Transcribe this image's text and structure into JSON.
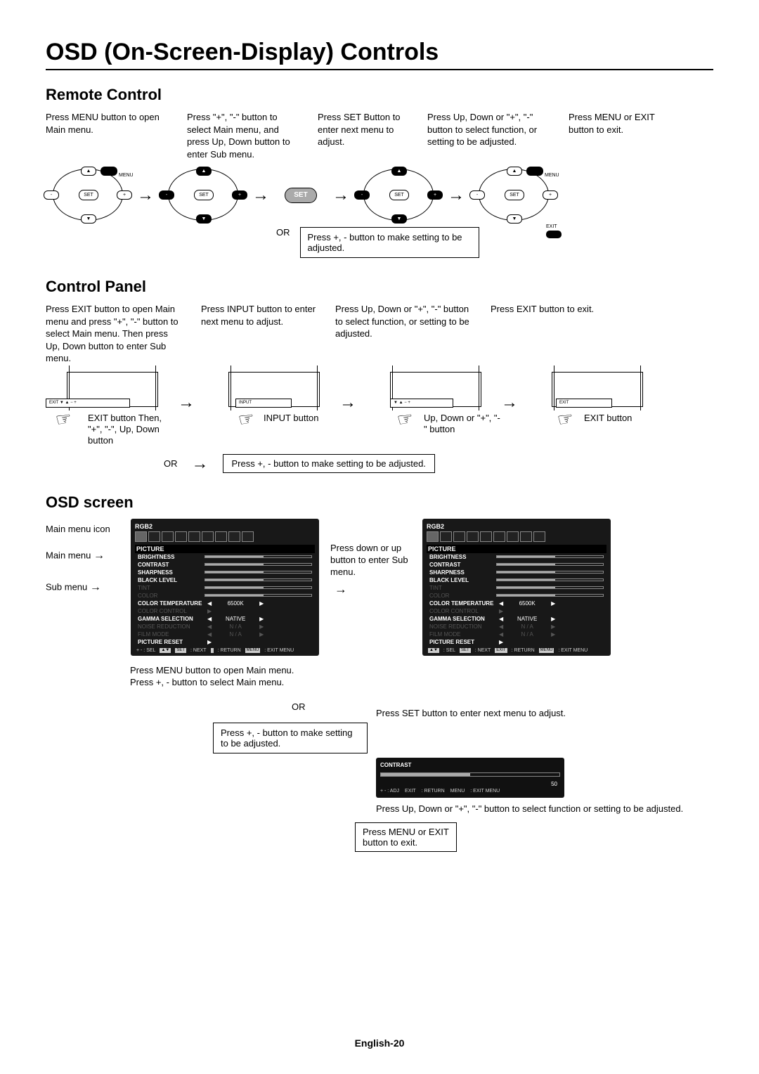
{
  "title": "OSD (On-Screen-Display) Controls",
  "footer": "English-20",
  "sections": {
    "remote": {
      "heading": "Remote Control",
      "steps": [
        "Press MENU button to open Main menu.",
        "Press \"+\", \"-\" button to select Main menu, and press Up, Down button to enter Sub menu.",
        "Press SET Button to enter next menu to adjust.",
        "Press Up, Down or \"+\", \"-\" button to select function, or setting to be adjusted.",
        "Press MENU or EXIT button to exit."
      ],
      "or": "OR",
      "or_text": "Press +, - button to make setting to be adjusted.",
      "btn_set": "SET",
      "btn_menu": "MENU",
      "btn_exit": "EXIT",
      "plus": "+",
      "minus": "-",
      "up": "▲",
      "down": "▼"
    },
    "panel": {
      "heading": "Control Panel",
      "steps": [
        "Press EXIT button to open Main menu and press \"+\", \"-\" button to select Main menu. Then press Up, Down button to enter Sub menu.",
        "Press INPUT button to enter next menu to adjust.",
        "Press Up, Down or  \"+\", \"-\" button to select function, or setting to be adjusted.",
        "Press EXIT button to exit."
      ],
      "labels": [
        "EXIT button Then, \"+\", \"-\", Up, Down button",
        "INPUT button",
        "Up, Down or \"+\", \"-\" button",
        "EXIT button"
      ],
      "btn_strip1": "EXIT  ▼ ▲  −  +",
      "btn_strip2": "INPUT",
      "btn_strip3": "▼ ▲  − +",
      "btn_strip4": "EXIT",
      "or": "OR",
      "or_text": "Press +, - button to make setting to be adjusted."
    },
    "osd": {
      "heading": "OSD screen",
      "side_labels": {
        "icon": "Main menu icon",
        "main": "Main menu",
        "sub": "Sub menu"
      },
      "mid_text": "Press down or up button to enter Sub menu.",
      "below1a": "Press MENU button to open Main menu.",
      "below1b": "Press +, - button to select Main menu.",
      "or": "OR",
      "box2": "Press +, - button to make setting to be adjusted.",
      "rlabel": "Press SET button to enter next menu to adjust.",
      "below3": "Press Up, Down or \"+\", \"-\" button to select function or setting to be adjusted.",
      "exit_box": "Press MENU or EXIT button to exit.",
      "panel": {
        "source": "RGB2",
        "title": "PICTURE",
        "rows": [
          {
            "name": "BRIGHTNESS",
            "kind": "bar",
            "bold": true
          },
          {
            "name": "CONTRAST",
            "kind": "bar",
            "bold": true
          },
          {
            "name": "SHARPNESS",
            "kind": "bar",
            "bold": true
          },
          {
            "name": "BLACK LEVEL",
            "kind": "bar",
            "bold": true
          },
          {
            "name": "TINT",
            "kind": "bar",
            "dim": true
          },
          {
            "name": "COLOR",
            "kind": "bar",
            "dim": true
          },
          {
            "name": "COLOR TEMPERATURE",
            "kind": "val",
            "val": "6500K",
            "bold": true
          },
          {
            "name": "COLOR CONTROL",
            "kind": "arr",
            "dim": true
          },
          {
            "name": "GAMMA SELECTION",
            "kind": "val",
            "val": "NATIVE",
            "bold": true
          },
          {
            "name": "NOISE REDUCTION",
            "kind": "val",
            "val": "N / A",
            "dim": true
          },
          {
            "name": "FILM MODE",
            "kind": "val",
            "val": "N / A",
            "dim": true
          },
          {
            "name": "PICTURE RESET",
            "kind": "arr",
            "bold": true
          }
        ],
        "foot1": {
          "sel": "+ - : SEL",
          "next": ": NEXT",
          "ret": ": RETURN",
          "exit": ": EXIT MENU",
          "k1": "▲▼",
          "k2": "SET",
          "k3": "EXIT",
          "k4": "MENU"
        },
        "foot2": {
          "sel": ": SEL",
          "next": ": NEXT",
          "ret": ": RETURN",
          "exit": ": EXIT MENU",
          "k0": "▲▼",
          "k2": "SET",
          "k3": "EXIT",
          "k4": "MENU"
        }
      },
      "contrast": {
        "title": "CONTRAST",
        "value": "50",
        "foot": {
          "adj": "+ - : ADJ",
          "ret": ": RETURN",
          "exit": ": EXIT MENU",
          "k1": "EXIT",
          "k2": "MENU"
        }
      }
    }
  }
}
